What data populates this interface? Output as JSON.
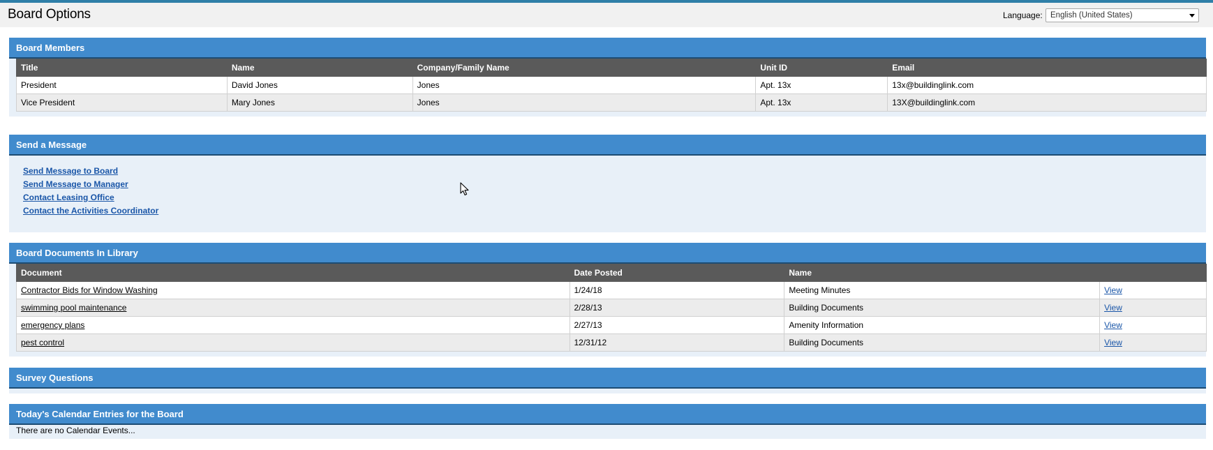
{
  "header": {
    "title": "Board Options",
    "language_label": "Language:",
    "language_value": "English (United States)"
  },
  "board_members": {
    "heading": "Board Members",
    "columns": [
      "Title",
      "Name",
      "Company/Family Name",
      "Unit ID",
      "Email"
    ],
    "rows": [
      [
        "President",
        "David Jones",
        "Jones",
        "Apt. 13x",
        "13x@buildinglink.com"
      ],
      [
        "Vice President",
        "Mary Jones",
        "Jones",
        "Apt. 13x",
        "13X@buildinglink.com"
      ]
    ]
  },
  "send_message": {
    "heading": "Send a Message",
    "links": [
      "Send Message to Board",
      "Send Message to Manager",
      "Contact Leasing Office",
      "Contact the Activities Coordinator"
    ]
  },
  "documents": {
    "heading": "Board Documents In Library",
    "columns": [
      "Document",
      "Date Posted",
      "Name",
      ""
    ],
    "rows": [
      [
        "Contractor Bids for Window Washing",
        "1/24/18",
        "Meeting Minutes",
        "View"
      ],
      [
        "swimming pool maintenance",
        "2/28/13",
        "Building Documents",
        "View"
      ],
      [
        "emergency plans",
        "2/27/13",
        "Amenity Information",
        "View"
      ],
      [
        "pest control",
        "12/31/12",
        "Building Documents",
        "View"
      ]
    ]
  },
  "survey": {
    "heading": "Survey Questions"
  },
  "calendar": {
    "heading": "Today's Calendar Entries for the Board",
    "empty_text": "There are no Calendar Events..."
  },
  "icons": {
    "cursor": "mouse-pointer-icon",
    "dropdown": "chevron-down-icon"
  },
  "colors": {
    "section_header": "#418bcd",
    "table_header": "#5a5a5a",
    "link": "#1a56a8",
    "section_bg": "#e8f0f8"
  }
}
